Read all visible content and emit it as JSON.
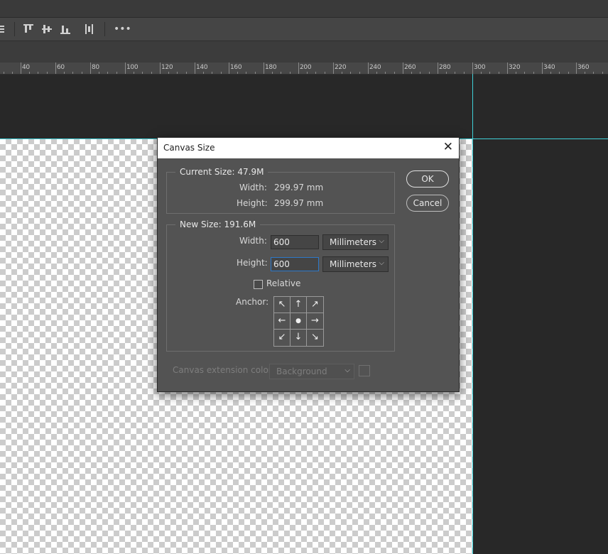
{
  "options_bar": {
    "icons": [
      "align-bottom-icon",
      "align-top-edges-icon",
      "align-vertical-centers-icon",
      "align-bottom-edges-icon",
      "distribute-horizontal-icon",
      "more-options-icon"
    ]
  },
  "ruler": {
    "labels": [
      "40",
      "60",
      "80",
      "100",
      "120",
      "140",
      "160",
      "180",
      "200",
      "220",
      "240",
      "260",
      "280",
      "300",
      "320",
      "340",
      "360"
    ]
  },
  "dialog": {
    "title": "Canvas Size",
    "close_glyph": "✕",
    "current_size": {
      "label": "Current Size: 47.9M",
      "width_label": "Width:",
      "width_value": "299.97 mm",
      "height_label": "Height:",
      "height_value": "299.97 mm"
    },
    "new_size": {
      "label": "New Size: 191.6M",
      "width_label": "Width:",
      "width_value": "600",
      "width_unit": "Millimeters",
      "height_label": "Height:",
      "height_value": "600",
      "height_unit": "Millimeters",
      "relative_label": "Relative",
      "relative_checked": false,
      "anchor_label": "Anchor:",
      "anchor_glyphs": [
        "↖",
        "↑",
        "↗",
        "←",
        "●",
        "→",
        "↙",
        "↓",
        "↘"
      ]
    },
    "extension": {
      "label": "Canvas extension color:",
      "value": "Background"
    },
    "ok_label": "OK",
    "cancel_label": "Cancel"
  }
}
